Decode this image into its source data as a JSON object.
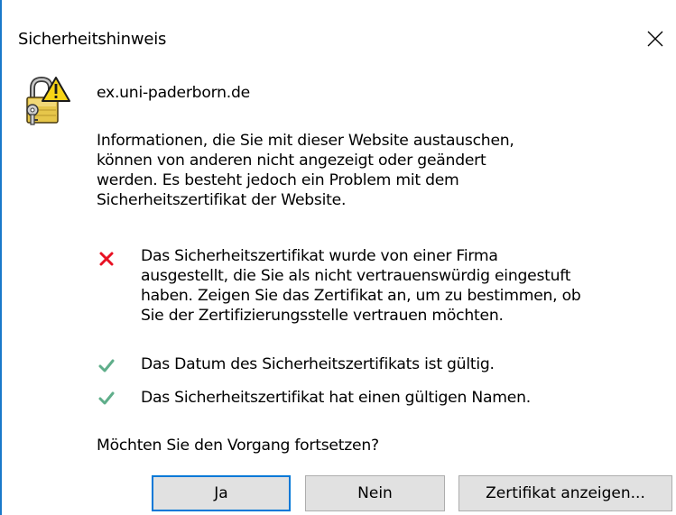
{
  "dialog": {
    "title": "Sicherheitshinweis",
    "close_icon": "close-icon",
    "warning_icon": "lock-warning-icon"
  },
  "site": "ex.uni-paderborn.de",
  "info_lines": [
    "Informationen, die Sie mit dieser Website austauschen,",
    "können von anderen nicht angezeigt oder geändert",
    "werden. Es besteht jedoch ein Problem mit dem",
    "Sicherheitszertifikat der Website."
  ],
  "checks": [
    {
      "status": "error",
      "icon": "red-x-icon",
      "color": "#e81123",
      "lines": [
        "Das Sicherheitszertifikat wurde von einer Firma",
        "ausgestellt, die Sie als nicht vertrauenswürdig eingestuft",
        "haben. Zeigen Sie das Zertifikat an, um zu bestimmen, ob",
        "Sie der Zertifizierungsstelle vertrauen möchten."
      ]
    },
    {
      "status": "ok",
      "icon": "green-check-icon",
      "color": "#5fae8a",
      "lines": [
        "Das Datum des Sicherheitszertifikats ist gültig."
      ]
    },
    {
      "status": "ok",
      "icon": "green-check-icon",
      "color": "#5fae8a",
      "lines": [
        "Das Sicherheitszertifikat hat einen gültigen Namen."
      ]
    }
  ],
  "question": "Möchten Sie den Vorgang fortsetzen?",
  "buttons": {
    "yes": "Ja",
    "no": "Nein",
    "view_certificate": "Zertifikat anzeigen..."
  },
  "colors": {
    "accent": "#0078d7",
    "button_bg": "#e1e1e1",
    "button_border": "#adadad",
    "window_edge": "#1979ca"
  }
}
